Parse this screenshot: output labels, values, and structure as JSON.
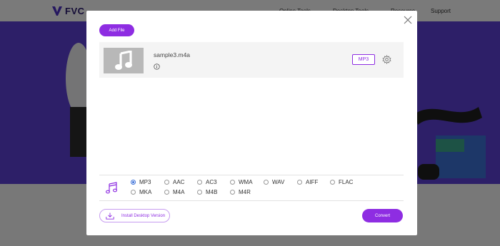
{
  "background": {
    "logo_text": "FVC",
    "nav": [
      "Online Tools",
      "Desktop Tools",
      "Resource",
      "Support"
    ]
  },
  "dialog": {
    "add_file_label": "Add File",
    "file": {
      "name": "sample3.m4a",
      "format_badge": "MP3"
    },
    "formats": [
      {
        "label": "MP3",
        "selected": true
      },
      {
        "label": "AAC",
        "selected": false
      },
      {
        "label": "AC3",
        "selected": false
      },
      {
        "label": "WMA",
        "selected": false
      },
      {
        "label": "WAV",
        "selected": false
      },
      {
        "label": "AIFF",
        "selected": false
      },
      {
        "label": "FLAC",
        "selected": false
      },
      {
        "label": "MKA",
        "selected": false
      },
      {
        "label": "M4A",
        "selected": false
      },
      {
        "label": "M4B",
        "selected": false
      },
      {
        "label": "M4R",
        "selected": false
      }
    ],
    "install_label": "Install Desktop Version",
    "convert_label": "Convert"
  },
  "colors": {
    "accent": "#8e2de2",
    "hero": "#5a3fd1",
    "radio_selected": "#3a6fd8"
  },
  "icons": [
    "close-icon",
    "music-note-icon",
    "info-icon",
    "gear-icon",
    "download-icon",
    "audio-file-icon"
  ]
}
